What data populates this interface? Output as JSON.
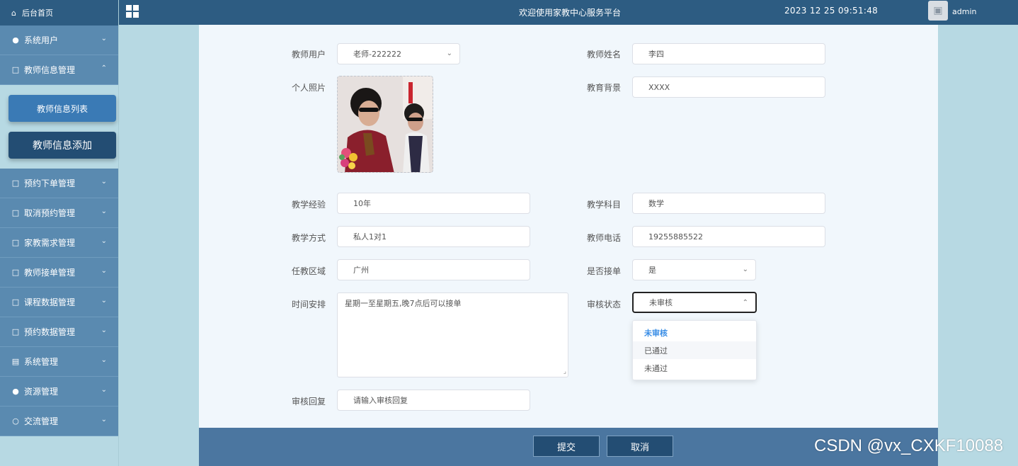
{
  "header": {
    "title": "欢迎使用家教中心服务平台",
    "time": "2023 12 25 09:51:48",
    "user": "admin"
  },
  "sidebar": {
    "home": "后台首页",
    "items": [
      {
        "label": "系统用户",
        "icon": "user-icon"
      },
      {
        "label": "教师信息管理",
        "icon": "doc-icon",
        "expanded": true
      },
      {
        "label": "预约下单管理",
        "icon": "doc-icon"
      },
      {
        "label": "取消预约管理",
        "icon": "doc-icon"
      },
      {
        "label": "家教需求管理",
        "icon": "doc-icon"
      },
      {
        "label": "教师接单管理",
        "icon": "doc-icon"
      },
      {
        "label": "课程数据管理",
        "icon": "doc-icon"
      },
      {
        "label": "预约数据管理",
        "icon": "doc-icon"
      },
      {
        "label": "系统管理",
        "icon": "chart-icon"
      },
      {
        "label": "资源管理",
        "icon": "bulb-icon"
      },
      {
        "label": "交流管理",
        "icon": "chat-icon"
      }
    ],
    "sub_items": [
      "教师信息列表",
      "教师信息添加"
    ]
  },
  "form": {
    "teacher_user_label": "教师用户",
    "teacher_user_value": "老师-222222",
    "teacher_name_label": "教师姓名",
    "teacher_name_value": "李四",
    "photo_label": "个人照片",
    "education_label": "教育背景",
    "education_value": "XXXX",
    "experience_label": "教学经验",
    "experience_value": "10年",
    "subject_label": "教学科目",
    "subject_value": "数学",
    "method_label": "教学方式",
    "method_value": "私人1对1",
    "phone_label": "教师电话",
    "phone_value": "19255885522",
    "region_label": "任教区域",
    "region_value": "广州",
    "accept_label": "是否接单",
    "accept_value": "是",
    "schedule_label": "时间安排",
    "schedule_value": "星期一至星期五,晚7点后可以接单",
    "review_status_label": "审核状态",
    "review_status_value": "未审核",
    "review_reply_label": "审核回复",
    "review_reply_placeholder": "请输入审核回复"
  },
  "dropdown": {
    "options": [
      "未审核",
      "已通过",
      "未通过"
    ]
  },
  "buttons": {
    "submit": "提交",
    "cancel": "取消"
  },
  "watermark": "CSDN @vx_CXKF10088"
}
